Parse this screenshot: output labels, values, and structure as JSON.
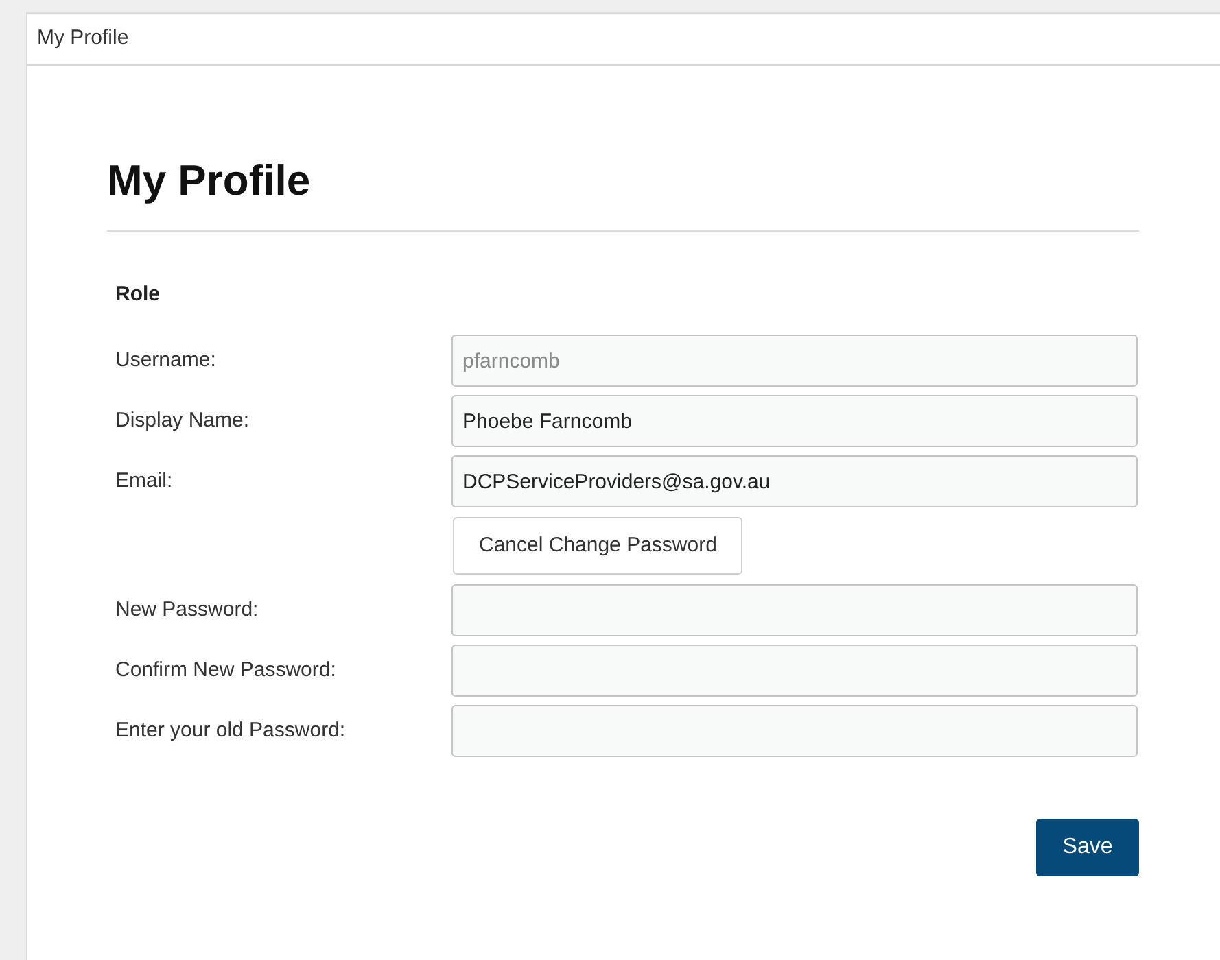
{
  "window": {
    "title": "My Profile"
  },
  "heading": "My Profile",
  "section": "Role",
  "rows": [
    {
      "kind": "field",
      "label": "Username:",
      "value": "pfarncomb",
      "disabled": true
    },
    {
      "kind": "field",
      "label": "Display Name:",
      "value": "Phoebe Farncomb",
      "disabled": false
    },
    {
      "kind": "field",
      "label": "Email:",
      "value": "DCPServiceProviders@sa.gov.au",
      "disabled": false
    },
    {
      "kind": "button",
      "label": "Cancel Change Password"
    },
    {
      "kind": "field",
      "label": "New Password:"
    },
    {
      "kind": "field",
      "label": "Confirm New Password:"
    },
    {
      "kind": "field",
      "label": "Enter your old Password:"
    }
  ],
  "save_button": "Save"
}
